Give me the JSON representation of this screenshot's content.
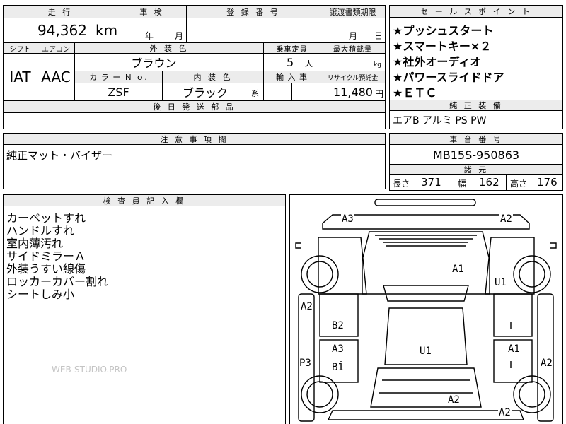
{
  "top": {
    "mileage_label": "走 行",
    "mileage_value": "94,362",
    "mileage_unit": "km",
    "inspection_label": "車 検",
    "inspection_year": "年",
    "inspection_month": "月",
    "registration_label": "登 録 番 号",
    "transfer_label": "譲渡書類期限",
    "transfer_month": "月",
    "transfer_day": "日",
    "shift_label": "シフト",
    "aircon_label": "エアコン",
    "shift_value": "IAT",
    "aircon_value": "AAC",
    "exterior_label": "外 装 色",
    "exterior_value": "ブラウン",
    "capacity_label": "乗車定員",
    "capacity_value": "5",
    "capacity_unit": "人",
    "maxload_label": "最大積載量",
    "maxload_unit": "kg",
    "colorno_label": "カ ラ ー Ｎ ｏ.",
    "colorno_value": "ZSF",
    "interior_label": "内 装 色",
    "interior_value": "ブラック",
    "interior_suffix": "系",
    "import_label": "輸 入 車",
    "recycle_label": "リサイクル預託金",
    "recycle_value": "11,480",
    "recycle_unit": "円",
    "later_parts_label": "後 日 発 送 部 品"
  },
  "sales_points": {
    "label": "セ ー ル ス ポ イ ン ト",
    "items": [
      "★プッシュスタート",
      "★スマートキー×２",
      "★社外オーディオ",
      "★パワースライドドア",
      "★ＥＴＣ"
    ]
  },
  "equipment": {
    "label": "純 正 装 備",
    "value": "エアB アルミ PS PW"
  },
  "notes": {
    "label": "注 意 事 項 欄",
    "value": "純正マット・バイザー"
  },
  "chassis": {
    "label": "車 台 番 号",
    "value": "MB15S-950863"
  },
  "dimensions": {
    "label": "諸 元",
    "length_label": "長さ",
    "length_value": "371",
    "width_label": "幅",
    "width_value": "162",
    "height_label": "高さ",
    "height_value": "176"
  },
  "inspector": {
    "label": "検 査 員 記 入 欄",
    "lines": [
      "カーペットすれ",
      "ハンドルすれ",
      "室内薄汚れ",
      "サイドミラーＡ",
      "外装うすい線傷",
      "ロッカーカバー割れ",
      "シートしみ小"
    ]
  },
  "watermark": "WEB-STUDIO.PRO",
  "damage": {
    "a3_top": "A3",
    "a2_top_right": "A2",
    "a1_hood": "A1",
    "u1_right_front": "U1",
    "a2_left_side": "A2",
    "b2_left": "B2",
    "a3_left_door": "A3",
    "b1_left_door": "B1",
    "u1_roof": "U1",
    "a1_right_door": "A1",
    "p3_left": "P3",
    "a2_right_side": "A2",
    "a2_rear_center": "A2",
    "a2_bottom_right": "A2"
  }
}
